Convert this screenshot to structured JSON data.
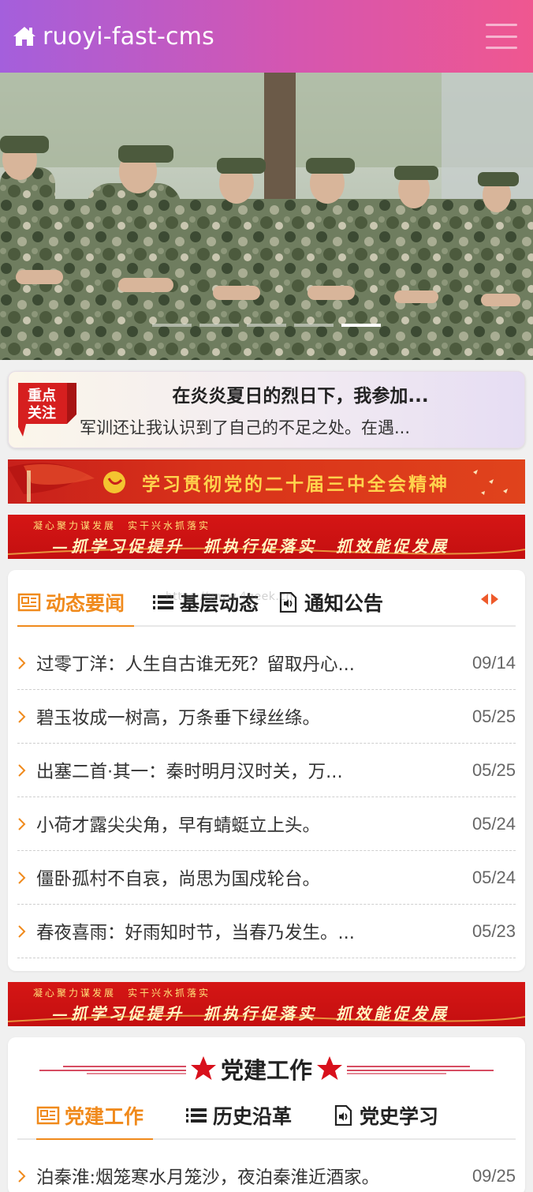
{
  "header": {
    "title": "ruoyi-fast-cms",
    "home_icon": "home-icon",
    "menu_icon": "hamburger-menu-icon"
  },
  "banner": {
    "slide_count": 5,
    "active_index": 4
  },
  "focus": {
    "badge_line1": "重点",
    "badge_line2": "关注",
    "title": "在炎炎夏日的烈日下，我参加...",
    "desc": "军训还让我认识到了自己的不足之处。在遇..."
  },
  "banners": {
    "b1_text": "学习贯彻党的二十届三中全会精神",
    "b2_small": "凝心聚力谋发展　实干兴水抓落实",
    "b2_big": "—抓学习促提升　抓执行促落实　抓效能促发展",
    "b3_small": "凝心聚力谋发展　实干兴水抓落实",
    "b3_big": "—抓学习促提升　抓执行促落实　抓效能促发展"
  },
  "news": {
    "watermark": "https://www.4geek.cn",
    "tabs": [
      {
        "label": "动态要闻",
        "icon": "newspaper-icon"
      },
      {
        "label": "基层动态",
        "icon": "list-icon"
      },
      {
        "label": "通知公告",
        "icon": "document-audio-icon"
      }
    ],
    "items": [
      {
        "title": "过零丁洋：人生自古谁无死？留取丹心...",
        "date": "09/14"
      },
      {
        "title": "碧玉妆成一树高，万条垂下绿丝绦。",
        "date": "05/25"
      },
      {
        "title": "出塞二首·其一：秦时明月汉时关，万...",
        "date": "05/25"
      },
      {
        "title": "小荷才露尖尖角，早有蜻蜓立上头。",
        "date": "05/24"
      },
      {
        "title": "僵卧孤村不自哀，尚思为国戍轮台。",
        "date": "05/24"
      },
      {
        "title": "春夜喜雨：好雨知时节，当春乃发生。...",
        "date": "05/23"
      }
    ]
  },
  "party": {
    "title": "党建工作",
    "tabs": [
      {
        "label": "党建工作",
        "icon": "newspaper-icon"
      },
      {
        "label": "历史沿革",
        "icon": "list-icon"
      },
      {
        "label": "党史学习",
        "icon": "document-audio-icon"
      }
    ],
    "items": [
      {
        "title": "泊秦淮:烟笼寒水月笼沙，夜泊秦淮近酒家。",
        "date": "09/25"
      }
    ]
  },
  "colors": {
    "header_start": "#a45fdc",
    "header_end": "#ef5790",
    "accent_orange": "#f08a1c",
    "party_red": "#c8102e"
  }
}
